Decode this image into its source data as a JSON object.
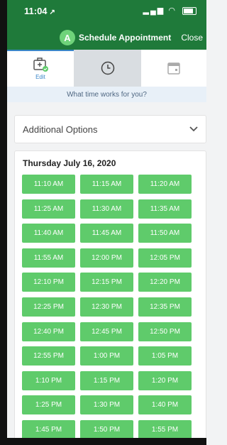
{
  "status_bar": {
    "time": "11:04",
    "location_arrow": "↗"
  },
  "header": {
    "app_badge": "A",
    "title": "Schedule Appointment",
    "close_label": "Close",
    "color": "#1f7a3a"
  },
  "tabs": [
    {
      "label": "Edit",
      "icon": "briefcase-check-icon",
      "active": true
    },
    {
      "label": "",
      "icon": "clock-icon",
      "selected": true
    },
    {
      "label": "",
      "icon": "calendar-icon"
    }
  ],
  "prompt": "What time works for you?",
  "options": {
    "label": "Additional Options",
    "icon": "chevron-down-icon"
  },
  "schedule": {
    "date": "Thursday July 16, 2020",
    "slot_color": "#5fcb6b",
    "slots": [
      "11:10 AM",
      "11:15 AM",
      "11:20 AM",
      "11:25 AM",
      "11:30 AM",
      "11:35 AM",
      "11:40 AM",
      "11:45 AM",
      "11:50 AM",
      "11:55 AM",
      "12:00 PM",
      "12:05 PM",
      "12:10 PM",
      "12:15 PM",
      "12:20 PM",
      "12:25 PM",
      "12:30 PM",
      "12:35 PM",
      "12:40 PM",
      "12:45 PM",
      "12:50 PM",
      "12:55 PM",
      "1:00 PM",
      "1:05 PM",
      "1:10 PM",
      "1:15 PM",
      "1:20 PM",
      "1:25 PM",
      "1:30 PM",
      "1:40 PM",
      "1:45 PM",
      "1:50 PM",
      "1:55 PM"
    ]
  }
}
